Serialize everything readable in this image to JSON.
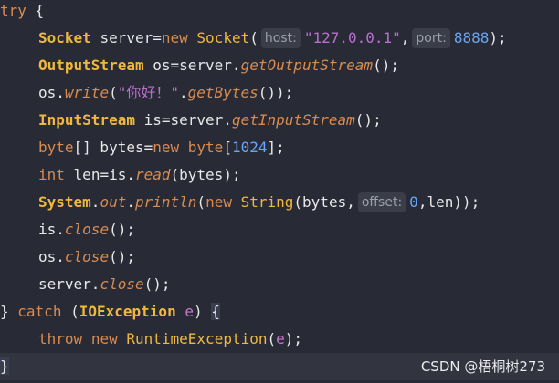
{
  "code": {
    "l1": {
      "kw_try": "try",
      "brace": "{"
    },
    "l2": {
      "type": "Socket",
      "var": "server=",
      "kw_new": "new",
      "ctor": "Socket",
      "paren": "(",
      "hint_host": "host:",
      "str": "\"127.0.0.1\"",
      "comma": ",",
      "hint_port": "port:",
      "num": "8888",
      "end": ");"
    },
    "l3": {
      "type": "OutputStream",
      "assign": "os=server.",
      "method": "getOutputStream",
      "end": "();"
    },
    "l4": {
      "obj": "os.",
      "method": "write",
      "open": "(",
      "str": "\"你好！\"",
      "dot": ".",
      "method2": "getBytes",
      "end": "());"
    },
    "l5": {
      "type": "InputStream",
      "assign": "is=server.",
      "method": "getInputStream",
      "end": "();"
    },
    "l6": {
      "kw_byte": "byte",
      "brackets": "[] bytes=",
      "kw_new": "new",
      "kw_byte2": "byte",
      "open": "[",
      "num": "1024",
      "end": "];"
    },
    "l7": {
      "kw_int": "int",
      "assign": "len=is.",
      "method": "read",
      "end": "(bytes);"
    },
    "l8": {
      "type": "System",
      "dot1": ".",
      "field": "out",
      "dot2": ".",
      "method": "println",
      "open": "(",
      "kw_new": "new",
      "ctor": "String",
      "args": "(bytes,",
      "hint_offset": "offset:",
      "num": "0",
      "end": ",len));"
    },
    "l9": {
      "obj": "is.",
      "method": "close",
      "end": "();"
    },
    "l10": {
      "obj": "os.",
      "method": "close",
      "end": "();"
    },
    "l11": {
      "obj": "server.",
      "method": "close",
      "end": "();"
    },
    "l12": {
      "close": "}",
      "kw_catch": "catch",
      "open": "(",
      "type": "IOException",
      "param": "e",
      "close_paren": ")",
      "brace": "{"
    },
    "l13": {
      "kw_throw": "throw",
      "kw_new": "new",
      "ctor": "RuntimeException",
      "open": "(",
      "param": "e",
      "end": ");"
    },
    "l14": {
      "brace": "}"
    }
  },
  "watermark": "CSDN @梧桐树273",
  "colors": {
    "background": "#282a36",
    "keyword": "#d98c4f",
    "class": "#f0b93d",
    "string": "#b96fce",
    "number": "#6aa6f5",
    "hint_bg": "#3b3d49"
  }
}
